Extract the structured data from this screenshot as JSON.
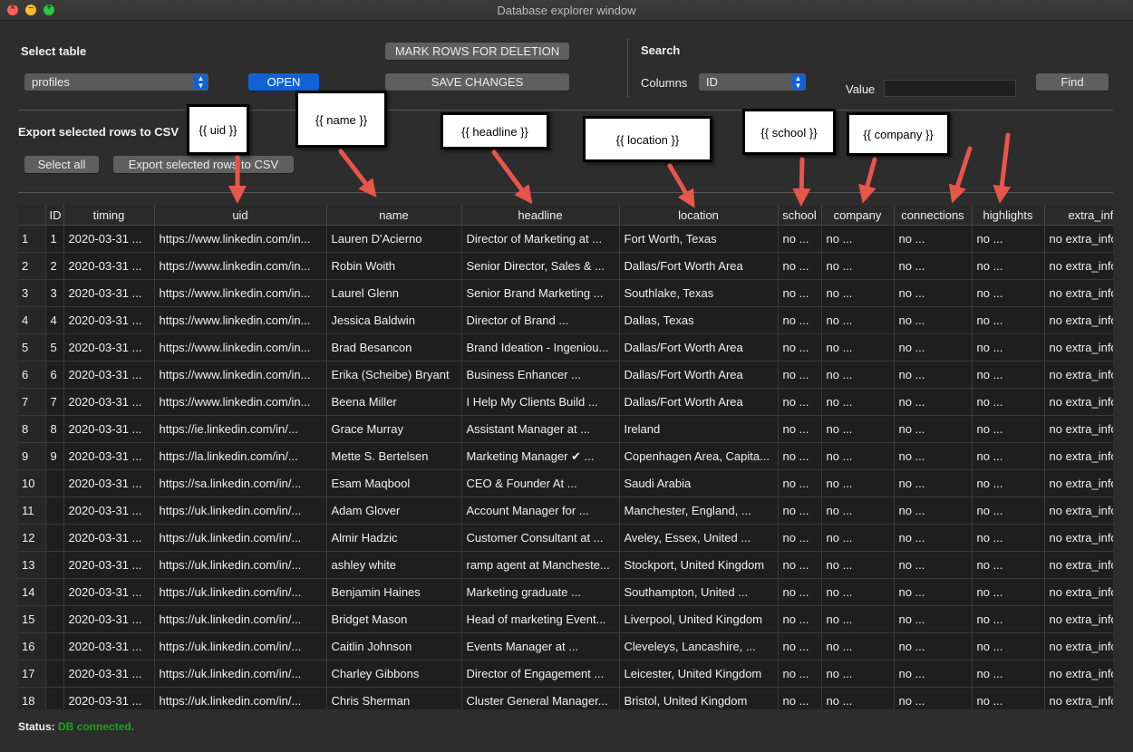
{
  "window": {
    "title": "Database explorer window"
  },
  "select_table": {
    "label": "Select table",
    "selected": "profiles",
    "open_button": "OPEN",
    "mark_button": "MARK ROWS FOR DELETION",
    "save_button": "SAVE CHANGES"
  },
  "search": {
    "heading": "Search",
    "columns_label": "Columns",
    "columns_selected": "ID",
    "value_label": "Value",
    "value": "",
    "find_button": "Find"
  },
  "export": {
    "heading": "Export selected rows to CSV",
    "select_all_button": "Select all",
    "export_button": "Export selected rows to CSV"
  },
  "table": {
    "columns": [
      "ID",
      "timing",
      "uid",
      "name",
      "headline",
      "location",
      "school",
      "company",
      "connections",
      "highlights",
      "extra_info"
    ],
    "rows": [
      [
        "1",
        "1",
        "2020-03-31 ...",
        "https://www.linkedin.com/in...",
        "Lauren D'Acierno",
        "Director of Marketing at ...",
        "Fort Worth, Texas",
        "no ...",
        "no ...",
        "no ...",
        "no ...",
        "no extra_info"
      ],
      [
        "2",
        "2",
        "2020-03-31 ...",
        "https://www.linkedin.com/in...",
        "Robin Woith",
        "Senior Director, Sales & ...",
        "Dallas/Fort Worth Area",
        "no ...",
        "no ...",
        "no ...",
        "no ...",
        "no extra_info"
      ],
      [
        "3",
        "3",
        "2020-03-31 ...",
        "https://www.linkedin.com/in...",
        "Laurel Glenn",
        "Senior Brand Marketing ...",
        "Southlake, Texas",
        "no ...",
        "no ...",
        "no ...",
        "no ...",
        "no extra_info"
      ],
      [
        "4",
        "4",
        "2020-03-31 ...",
        "https://www.linkedin.com/in...",
        "Jessica Baldwin",
        "Director of Brand ...",
        "Dallas, Texas",
        "no ...",
        "no ...",
        "no ...",
        "no ...",
        "no extra_info"
      ],
      [
        "5",
        "5",
        "2020-03-31 ...",
        "https://www.linkedin.com/in...",
        "Brad Besancon",
        "Brand Ideation - Ingeniou...",
        "Dallas/Fort Worth Area",
        "no ...",
        "no ...",
        "no ...",
        "no ...",
        "no extra_info"
      ],
      [
        "6",
        "6",
        "2020-03-31 ...",
        "https://www.linkedin.com/in...",
        "Erika (Scheibe) Bryant",
        "Business Enhancer ...",
        "Dallas/Fort Worth Area",
        "no ...",
        "no ...",
        "no ...",
        "no ...",
        "no extra_info"
      ],
      [
        "7",
        "7",
        "2020-03-31 ...",
        "https://www.linkedin.com/in...",
        "Beena Miller",
        "I Help My Clients Build ...",
        "Dallas/Fort Worth Area",
        "no ...",
        "no ...",
        "no ...",
        "no ...",
        "no extra_info"
      ],
      [
        "8",
        "8",
        "2020-03-31 ...",
        "https://ie.linkedin.com/in/...",
        "Grace Murray",
        "Assistant Manager at ...",
        "Ireland",
        "no ...",
        "no ...",
        "no ...",
        "no ...",
        "no extra_info"
      ],
      [
        "9",
        "9",
        "2020-03-31 ...",
        "https://la.linkedin.com/in/...",
        "Mette S. Bertelsen",
        "Marketing Manager ✔ ...",
        "Copenhagen Area, Capita...",
        "no ...",
        "no ...",
        "no ...",
        "no ...",
        "no extra_info"
      ],
      [
        "10",
        "",
        "2020-03-31 ...",
        "https://sa.linkedin.com/in/...",
        "Esam Maqbool",
        "CEO & Founder At ...",
        "Saudi Arabia",
        "no ...",
        "no ...",
        "no ...",
        "no ...",
        "no extra_info"
      ],
      [
        "11",
        "",
        "2020-03-31 ...",
        "https://uk.linkedin.com/in/...",
        "Adam Glover",
        "Account Manager for ...",
        "Manchester, England, ...",
        "no ...",
        "no ...",
        "no ...",
        "no ...",
        "no extra_info"
      ],
      [
        "12",
        "",
        "2020-03-31 ...",
        "https://uk.linkedin.com/in/...",
        "Almir Hadzic",
        "Customer Consultant at ...",
        "Aveley, Essex, United ...",
        "no ...",
        "no ...",
        "no ...",
        "no ...",
        "no extra_info"
      ],
      [
        "13",
        "",
        "2020-03-31 ...",
        "https://uk.linkedin.com/in/...",
        "ashley white",
        "ramp agent at Mancheste...",
        "Stockport, United Kingdom",
        "no ...",
        "no ...",
        "no ...",
        "no ...",
        "no extra_info"
      ],
      [
        "14",
        "",
        "2020-03-31 ...",
        "https://uk.linkedin.com/in/...",
        "Benjamin Haines",
        "Marketing graduate ...",
        "Southampton, United ...",
        "no ...",
        "no ...",
        "no ...",
        "no ...",
        "no extra_info"
      ],
      [
        "15",
        "",
        "2020-03-31 ...",
        "https://uk.linkedin.com/in/...",
        "Bridget Mason",
        "Head of marketing Event...",
        "Liverpool, United Kingdom",
        "no ...",
        "no ...",
        "no ...",
        "no ...",
        "no extra_info"
      ],
      [
        "16",
        "",
        "2020-03-31 ...",
        "https://uk.linkedin.com/in/...",
        "Caitlin Johnson",
        "Events Manager at ...",
        "Cleveleys, Lancashire, ...",
        "no ...",
        "no ...",
        "no ...",
        "no ...",
        "no extra_info"
      ],
      [
        "17",
        "",
        "2020-03-31 ...",
        "https://uk.linkedin.com/in/...",
        "Charley Gibbons",
        "Director of Engagement ...",
        "Leicester, United Kingdom",
        "no ...",
        "no ...",
        "no ...",
        "no ...",
        "no extra_info"
      ],
      [
        "18",
        "",
        "2020-03-31 ...",
        "https://uk.linkedin.com/in/...",
        "Chris Sherman",
        "Cluster General Manager...",
        "Bristol, United Kingdom",
        "no ...",
        "no ...",
        "no ...",
        "no ...",
        "no extra_info"
      ]
    ]
  },
  "callouts": [
    "{{ uid }}",
    "{{ name }}",
    "{{ headline }}",
    "{{ location }}",
    "{{ school }}",
    "{{ company }}"
  ],
  "status": {
    "label": "Status:",
    "value": "DB connected."
  },
  "colors": {
    "accent": "#1062d6",
    "status_ok": "#1ea21e",
    "arrow": "#e8554a"
  }
}
